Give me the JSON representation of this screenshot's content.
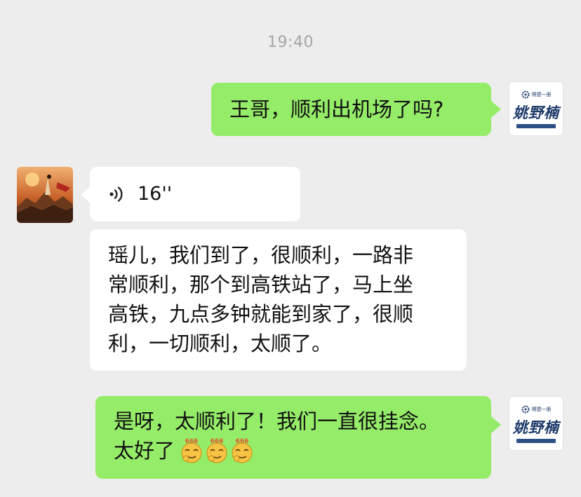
{
  "chat": {
    "timestamp": "19:40",
    "messages": [
      {
        "side": "right",
        "type": "text",
        "text": "王哥，顺利出机场了吗?"
      },
      {
        "side": "left",
        "type": "voice",
        "duration": "16''"
      },
      {
        "side": "left",
        "type": "text",
        "lines": [
          "瑶儿，我们到了，很顺利，一路非",
          "常顺利，那个到高铁站了，马上坐",
          "高铁，九点多钟就能到家了，很顺",
          "利，一切顺利，太顺了。"
        ]
      },
      {
        "side": "right",
        "type": "text",
        "lines": [
          "是呀，太顺利了！我们一直很挂念。",
          "太好了"
        ],
        "emoji_count": 3,
        "emoji_label": "666"
      }
    ]
  },
  "my_avatar": {
    "logo_small": "得盟一册",
    "logo_main": "姚野楠",
    "accent": "#1e3b6a"
  },
  "contact_avatar": {
    "icon": "landscape-art"
  },
  "colors": {
    "background": "#ededed",
    "my_bubble": "#95ec69",
    "their_bubble": "#ffffff",
    "timestamp": "#a6a6a6"
  }
}
